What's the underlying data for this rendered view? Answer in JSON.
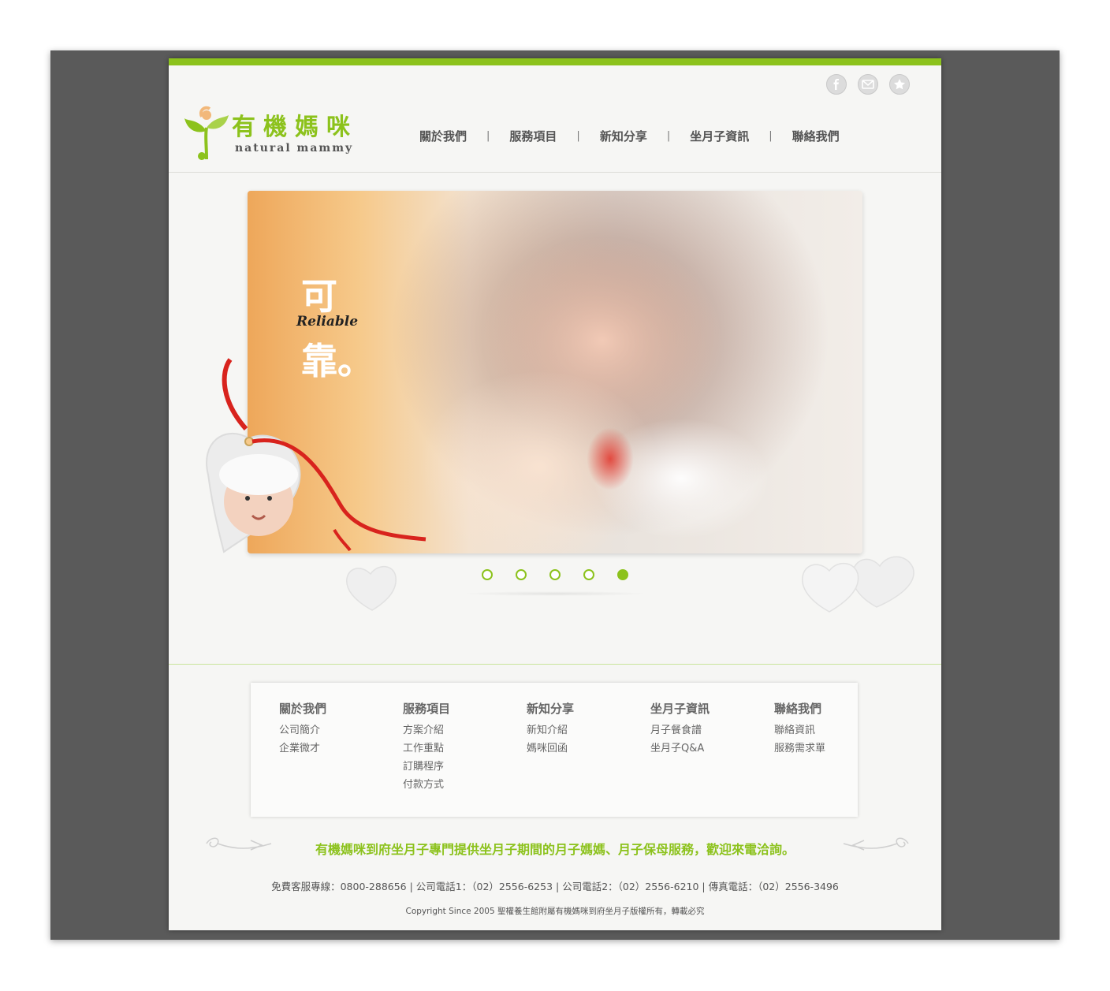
{
  "logo": {
    "cn": "有機媽咪",
    "en": "natural mammy"
  },
  "social": [
    {
      "icon": "facebook-icon"
    },
    {
      "icon": "mail-icon"
    },
    {
      "icon": "star-icon"
    }
  ],
  "nav": [
    "關於我們",
    "服務項目",
    "新知分享",
    "坐月子資訊",
    "聯絡我們"
  ],
  "hero": {
    "char1": "可",
    "en": "Reliable",
    "char2": "靠。"
  },
  "slider": {
    "count": 5,
    "active": 5
  },
  "footer": {
    "columns": [
      {
        "heading": "關於我們",
        "links": [
          "公司簡介",
          "企業微才"
        ]
      },
      {
        "heading": "服務項目",
        "links": [
          "方案介紹",
          "工作重點",
          "訂購程序",
          "付款方式"
        ]
      },
      {
        "heading": "新知分享",
        "links": [
          "新知介紹",
          "媽咪回函"
        ]
      },
      {
        "heading": "坐月子資訊",
        "links": [
          "月子餐食譜",
          "坐月子Q&A"
        ]
      },
      {
        "heading": "聯絡我們",
        "links": [
          "聯絡資訊",
          "服務需求單"
        ]
      }
    ],
    "slogan": "有機媽咪到府坐月子專門提供坐月子期間的月子媽媽、月子保母服務，歡迎來電洽詢。",
    "contact": "免費客服專線：0800-288656 | 公司電話1：（02）2556-6253 | 公司電話2：（02）2556-6210 | 傳真電話：（02）2556-3496",
    "copyright": "Copyright Since 2005 聖權養生館附屬有機媽咪到府坐月子版權所有，轉載必究"
  },
  "colors": {
    "accent": "#8cc21c",
    "frame": "#5a5a5a",
    "ribbon": "#d8231d"
  }
}
